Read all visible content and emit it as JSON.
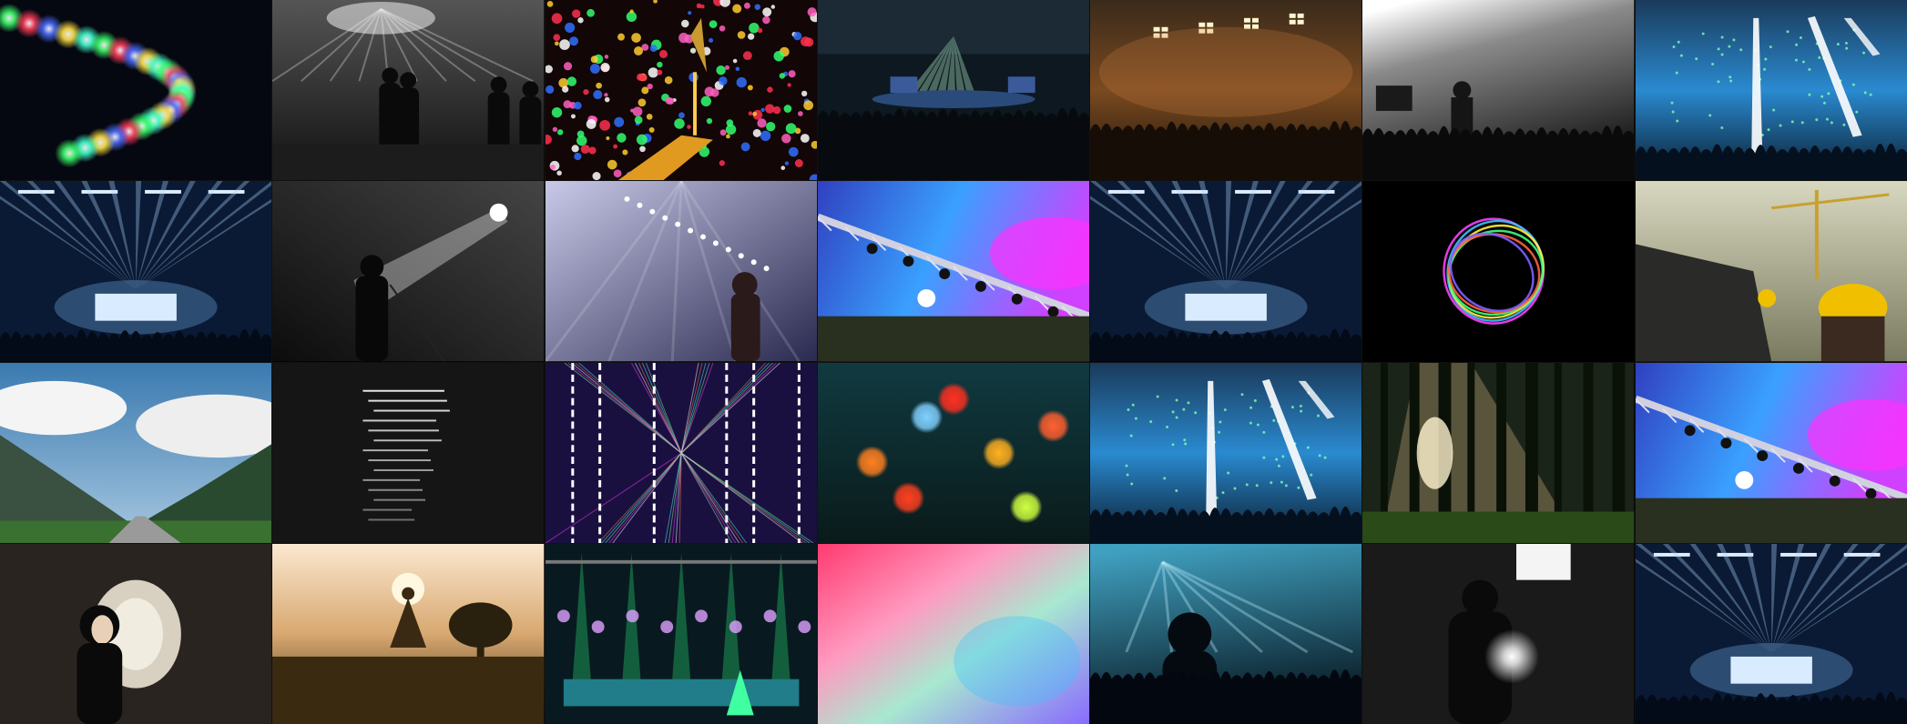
{
  "grid": {
    "columns": 7,
    "rows": 4,
    "tiles": [
      {
        "subject": "bokeh-string-lights"
      },
      {
        "subject": "bw-concert-silhouettes"
      },
      {
        "subject": "colorful-dots-ornament"
      },
      {
        "subject": "arena-stage-crowd"
      },
      {
        "subject": "warm-stage-lights-band"
      },
      {
        "subject": "concert-phone-crowd"
      },
      {
        "subject": "blue-laser-stage"
      },
      {
        "subject": "blue-beam-stage"
      },
      {
        "subject": "bw-singer-spotlight"
      },
      {
        "subject": "singer-tent-lights"
      },
      {
        "subject": "purple-truss-lights"
      },
      {
        "subject": "blue-beam-stage"
      },
      {
        "subject": "light-painting-circle"
      },
      {
        "subject": "construction-worker-crane"
      },
      {
        "subject": "mountain-road-clouds"
      },
      {
        "subject": "dark-light-stripes"
      },
      {
        "subject": "neon-laser-lines"
      },
      {
        "subject": "rain-bokeh-lights"
      },
      {
        "subject": "blue-laser-stage"
      },
      {
        "subject": "forest-sunbeam"
      },
      {
        "subject": "purple-truss-lights"
      },
      {
        "subject": "woman-tunnel"
      },
      {
        "subject": "sunset-field-woman"
      },
      {
        "subject": "green-stage-lanterns"
      },
      {
        "subject": "pastel-gradient"
      },
      {
        "subject": "teal-concert-crowd"
      },
      {
        "subject": "bw-man-light"
      },
      {
        "subject": "blue-beam-stage"
      }
    ]
  }
}
